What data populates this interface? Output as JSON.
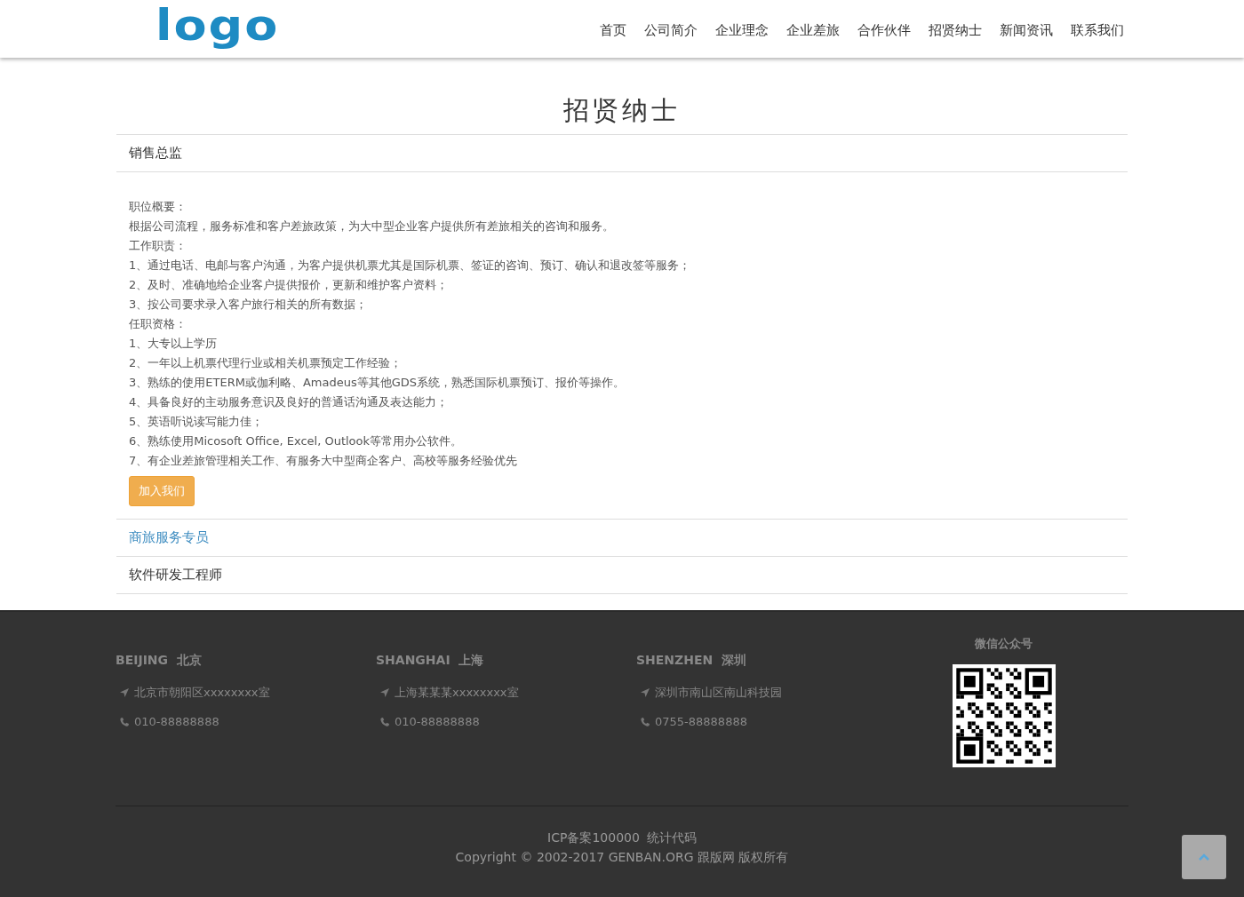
{
  "header": {
    "logo": "logo",
    "nav": [
      "首页",
      "公司简介",
      "企业理念",
      "企业差旅",
      "合作伙伴",
      "招贤纳士",
      "新闻资讯",
      "联系我们"
    ]
  },
  "page_title": "招贤纳士",
  "jobs": [
    {
      "title": "销售总监",
      "highlighted": false,
      "lines": [
        "职位概要：",
        "根据公司流程，服务标准和客户差旅政策，为大中型企业客户提供所有差旅相关的咨询和服务。",
        "工作职责：",
        "1、通过电话、电邮与客户沟通，为客户提供机票尤其是国际机票、签证的咨询、预订、确认和退改签等服务；",
        "2、及时、准确地给企业客户提供报价，更新和维护客户资料；",
        "3、按公司要求录入客户旅行相关的所有数据；",
        "任职资格：",
        "1、大专以上学历",
        "2、一年以上机票代理行业或相关机票预定工作经验；",
        "3、熟练的使用ETERM或伽利略、Amadeus等其他GDS系统，熟悉国际机票预订、报价等操作。",
        "4、具备良好的主动服务意识及良好的普通话沟通及表达能力；",
        "5、英语听说读写能力佳；",
        "6、熟练使用Micosoft Office, Excel, Outlook等常用办公软件。",
        "7、有企业差旅管理相关工作、有服务大中型商企客户、高校等服务经验优先"
      ],
      "button": "加入我们"
    },
    {
      "title": "商旅服务专员",
      "highlighted": true
    },
    {
      "title": "软件研发工程师",
      "highlighted": false
    }
  ],
  "footer": {
    "offices": [
      {
        "city_en": "BEIJING",
        "city_zh": "北京",
        "address": "北京市朝阳区xxxxxxxx室",
        "phone": "010-88888888"
      },
      {
        "city_en": "SHANGHAI",
        "city_zh": "上海",
        "address": "上海某某某xxxxxxxx室",
        "phone": "010-88888888"
      },
      {
        "city_en": "SHENZHEN",
        "city_zh": "深圳",
        "address": "深圳市南山区南山科技园",
        "phone": "0755-88888888"
      }
    ],
    "wechat_label": "微信公众号",
    "icp": "ICP备案100000",
    "stats": "统计代码",
    "copyright": "Copyright © 2002-2017 GENBAN.ORG 跟版网 版权所有"
  }
}
